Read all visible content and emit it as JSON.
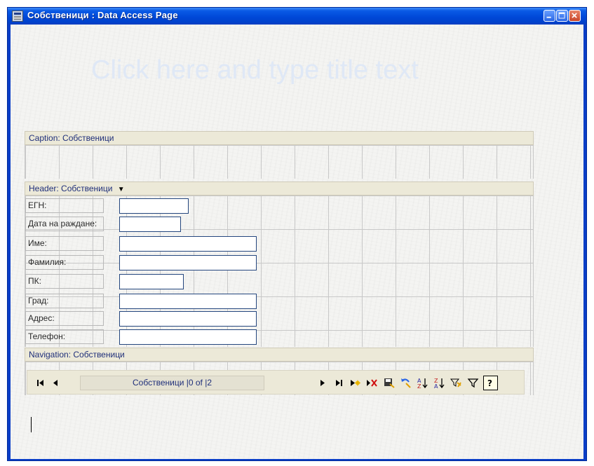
{
  "window": {
    "title": "Собственици : Data Access Page",
    "buttons": [
      "minimize",
      "maximize",
      "close"
    ]
  },
  "page": {
    "title_placeholder": "Click here and type title text"
  },
  "sections": {
    "caption": "Caption: Собственици",
    "header": "Header: Собственици",
    "header_dropdown": "▼",
    "navigation": "Navigation: Собственици"
  },
  "fields": [
    {
      "label": "ЕГН:"
    },
    {
      "label": "Дата на раждане:"
    },
    {
      "label": "Име:"
    },
    {
      "label": "Фамилия:"
    },
    {
      "label": "ПК:"
    },
    {
      "label": "Град:"
    },
    {
      "label": "Адрес:"
    },
    {
      "label": "Телефон:"
    }
  ],
  "navbar": {
    "record_text": "Собственици |0 of |2",
    "icons": {
      "first": "first-record-icon",
      "previous": "previous-record-icon",
      "next": "next-record-icon",
      "last": "last-record-icon",
      "new": "new-record-icon",
      "delete": "delete-record-icon",
      "save": "save-record-icon",
      "undo": "undo-icon",
      "sort_asc": "sort-ascending-icon",
      "sort_desc": "sort-descending-icon",
      "filter_by_selection": "filter-by-selection-icon",
      "toggle_filter": "toggle-filter-icon",
      "help": "help-icon"
    }
  },
  "colors": {
    "titlebar": "#0048d8",
    "section_band": "#ece9d8",
    "section_text": "#1f2f7a",
    "input_border": "#24467e",
    "placeholder_text": "#dfe8f6"
  }
}
